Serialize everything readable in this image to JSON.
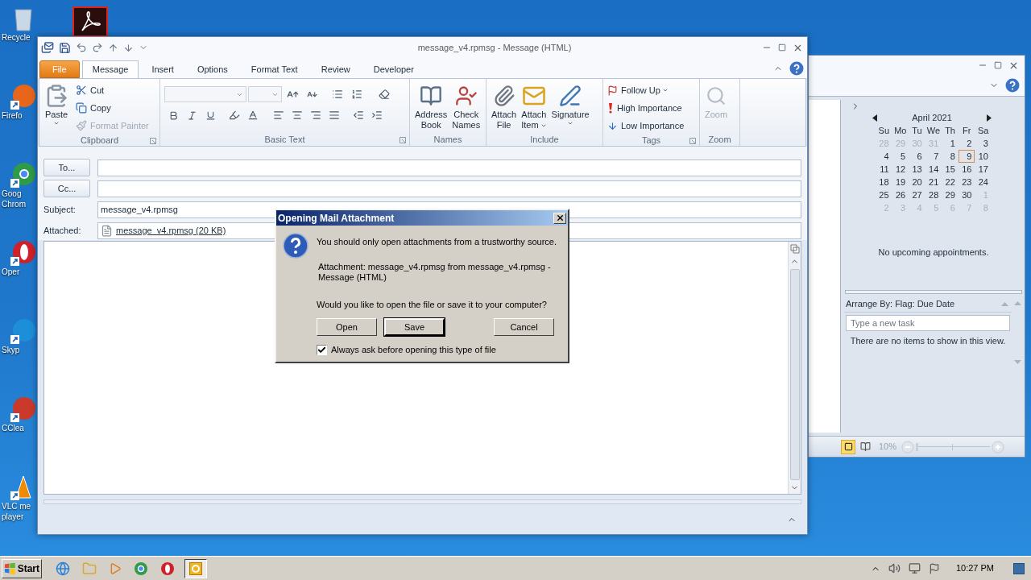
{
  "desktop": {
    "icons": [
      {
        "lines": [
          "Recycle"
        ]
      },
      {
        "lines": [
          "Firefo"
        ]
      },
      {
        "lines": [
          "Goog",
          "Chrom"
        ]
      },
      {
        "lines": [
          "Oper"
        ]
      },
      {
        "lines": [
          "Skyp"
        ]
      },
      {
        "lines": [
          "CClea"
        ]
      },
      {
        "lines": [
          "VLC me",
          "player"
        ]
      }
    ]
  },
  "message_window": {
    "title": "message_v4.rpmsg - Message (HTML)",
    "tabs": [
      {
        "label": "File",
        "kind": "file",
        "selected": false
      },
      {
        "label": "Message",
        "kind": "tab",
        "selected": true
      },
      {
        "label": "Insert",
        "kind": "tab",
        "selected": false
      },
      {
        "label": "Options",
        "kind": "tab",
        "selected": false
      },
      {
        "label": "Format Text",
        "kind": "tab",
        "selected": false
      },
      {
        "label": "Review",
        "kind": "tab",
        "selected": false
      },
      {
        "label": "Developer",
        "kind": "tab",
        "selected": false
      }
    ],
    "ribbon": {
      "clipboard": {
        "label": "Clipboard",
        "paste": "Paste",
        "cut": "Cut",
        "copy": "Copy",
        "format_painter": {
          "label": "Format Painter",
          "disabled": true
        }
      },
      "basic_text": {
        "label": "Basic Text"
      },
      "names": {
        "label": "Names",
        "address_book": [
          "Address",
          "Book"
        ],
        "check_names": [
          "Check",
          "Names"
        ]
      },
      "include": {
        "label": "Include",
        "attach_file": [
          "Attach",
          "File"
        ],
        "attach_item": [
          "Attach",
          "Item"
        ],
        "signature": [
          "Signature"
        ]
      },
      "tags": {
        "label": "Tags",
        "follow_up": "Follow Up",
        "high_importance": "High Importance",
        "low_importance": "Low Importance"
      },
      "zoom": {
        "label": "Zoom",
        "button": {
          "label": "Zoom",
          "disabled": true
        }
      }
    },
    "to_button": "To...",
    "cc_button": "Cc...",
    "subject_label": "Subject:",
    "subject_value": "message_v4.rpmsg",
    "attached_label": "Attached:",
    "attachment": "message_v4.rpmsg (20 KB)"
  },
  "dialog": {
    "title": "Opening Mail Attachment",
    "warning": "You should only open attachments from a trustworthy source.",
    "attachment_info": "Attachment: message_v4.rpmsg from message_v4.rpmsg - Message (HTML)",
    "question": "Would you like to open the file or save it to your computer?",
    "buttons": [
      {
        "label": "Open",
        "focused": false
      },
      {
        "label": "Save",
        "focused": true
      },
      {
        "label": "Cancel",
        "focused": false
      }
    ],
    "always_ask": {
      "label": "Always ask before opening this type of file",
      "checked": true
    }
  },
  "calendar_window": {
    "month": "April 2021",
    "weekdays": [
      "Su",
      "Mo",
      "Tu",
      "We",
      "Th",
      "Fr",
      "Sa"
    ],
    "weeks": [
      [
        {
          "day": "28",
          "other_month": true,
          "today": false
        },
        {
          "day": "29",
          "other_month": true,
          "today": false
        },
        {
          "day": "30",
          "other_month": true,
          "today": false
        },
        {
          "day": "31",
          "other_month": true,
          "today": false
        },
        {
          "day": "1",
          "other_month": false,
          "today": false
        },
        {
          "day": "2",
          "other_month": false,
          "today": false
        },
        {
          "day": "3",
          "other_month": false,
          "today": false
        }
      ],
      [
        {
          "day": "4",
          "other_month": false,
          "today": false
        },
        {
          "day": "5",
          "other_month": false,
          "today": false
        },
        {
          "day": "6",
          "other_month": false,
          "today": false
        },
        {
          "day": "7",
          "other_month": false,
          "today": false
        },
        {
          "day": "8",
          "other_month": false,
          "today": false
        },
        {
          "day": "9",
          "other_month": false,
          "today": true
        },
        {
          "day": "10",
          "other_month": false,
          "today": false
        }
      ],
      [
        {
          "day": "11",
          "other_month": false,
          "today": false
        },
        {
          "day": "12",
          "other_month": false,
          "today": false
        },
        {
          "day": "13",
          "other_month": false,
          "today": false
        },
        {
          "day": "14",
          "other_month": false,
          "today": false
        },
        {
          "day": "15",
          "other_month": false,
          "today": false
        },
        {
          "day": "16",
          "other_month": false,
          "today": false
        },
        {
          "day": "17",
          "other_month": false,
          "today": false
        }
      ],
      [
        {
          "day": "18",
          "other_month": false,
          "today": false
        },
        {
          "day": "19",
          "other_month": false,
          "today": false
        },
        {
          "day": "20",
          "other_month": false,
          "today": false
        },
        {
          "day": "21",
          "other_month": false,
          "today": false
        },
        {
          "day": "22",
          "other_month": false,
          "today": false
        },
        {
          "day": "23",
          "other_month": false,
          "today": false
        },
        {
          "day": "24",
          "other_month": false,
          "today": false
        }
      ],
      [
        {
          "day": "25",
          "other_month": false,
          "today": false
        },
        {
          "day": "26",
          "other_month": false,
          "today": false
        },
        {
          "day": "27",
          "other_month": false,
          "today": false
        },
        {
          "day": "28",
          "other_month": false,
          "today": false
        },
        {
          "day": "29",
          "other_month": false,
          "today": false
        },
        {
          "day": "30",
          "other_month": false,
          "today": false
        },
        {
          "day": "1",
          "other_month": true,
          "today": false
        }
      ],
      [
        {
          "day": "2",
          "other_month": true,
          "today": false
        },
        {
          "day": "3",
          "other_month": true,
          "today": false
        },
        {
          "day": "4",
          "other_month": true,
          "today": false
        },
        {
          "day": "5",
          "other_month": true,
          "today": false
        },
        {
          "day": "6",
          "other_month": true,
          "today": false
        },
        {
          "day": "7",
          "other_month": true,
          "today": false
        },
        {
          "day": "8",
          "other_month": true,
          "today": false
        }
      ]
    ],
    "appointments": "No upcoming appointments.",
    "arrange_by": "Arrange By: Flag: Due Date",
    "task_placeholder": "Type a new task",
    "empty_tasks": "There are no items to show in this view.",
    "zoom_level": "10%",
    "zoom_slider": {
      "level": 0.0
    }
  },
  "taskbar": {
    "start": "Start",
    "clock": "10:27 PM"
  }
}
